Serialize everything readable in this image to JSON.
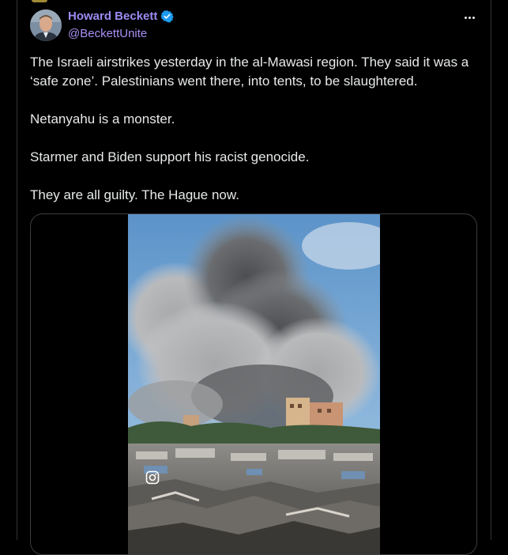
{
  "tweet": {
    "author": {
      "display_name": "Howard Beckett",
      "handle": "@BeckettUnite",
      "verified": true
    },
    "paragraphs": [
      "The Israeli airstrikes yesterday in the al-Mawasi region. They said it was a ‘safe zone’. Palestinians went there, into tents, to be slaughtered.",
      "Netanyahu is a monster.",
      "Starmer and Biden support his racist genocide.",
      "They are all guilty. The Hague now."
    ],
    "media": {
      "kind": "video",
      "overlay_icon": "instagram-icon"
    }
  },
  "icons": {
    "more": "more-options-icon",
    "verified": "verified-badge-icon"
  },
  "colors": {
    "background": "#000000",
    "text": "#e7e9ea",
    "name": "#9b8cf3",
    "verified": "#1d9bf0",
    "border": "#2f3336"
  }
}
